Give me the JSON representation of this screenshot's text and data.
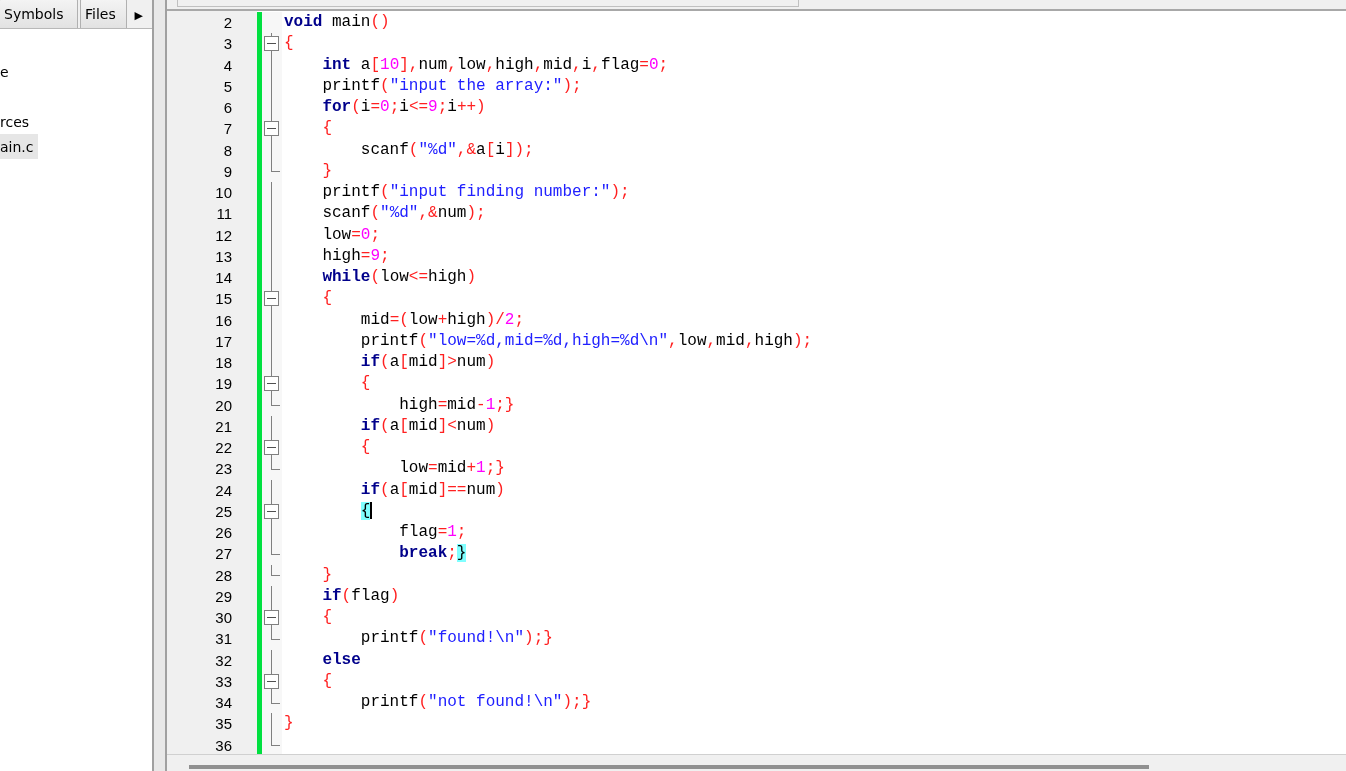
{
  "sidebar": {
    "tabs": [
      {
        "label": "Symbols",
        "selected": false
      },
      {
        "label": "Files",
        "selected": false
      }
    ],
    "scroll_button": "▶",
    "tree": [
      {
        "label": "e",
        "selected": false
      },
      {
        "label": "rces",
        "selected": false
      },
      {
        "label": "ain.c",
        "selected": true
      }
    ]
  },
  "editor": {
    "lines": [
      {
        "number": "2",
        "kind": "none",
        "tokens": [
          {
            "kind": "keyword",
            "text": "void"
          },
          {
            "kind": "name",
            "text": " main"
          },
          {
            "kind": "op",
            "text": "()"
          }
        ]
      },
      {
        "number": "3",
        "kind": "box",
        "tokens": [
          {
            "kind": "op",
            "text": "{"
          }
        ]
      },
      {
        "number": "4",
        "kind": "line",
        "tokens": [
          {
            "kind": "keyword",
            "text": "    int"
          },
          {
            "kind": "name",
            "text": " a"
          },
          {
            "kind": "op",
            "text": "["
          },
          {
            "kind": "number",
            "text": "10"
          },
          {
            "kind": "op",
            "text": "],"
          },
          {
            "kind": "name",
            "text": "num"
          },
          {
            "kind": "op",
            "text": ","
          },
          {
            "kind": "name",
            "text": "low"
          },
          {
            "kind": "op",
            "text": ","
          },
          {
            "kind": "name",
            "text": "high"
          },
          {
            "kind": "op",
            "text": ","
          },
          {
            "kind": "name",
            "text": "mid"
          },
          {
            "kind": "op",
            "text": ","
          },
          {
            "kind": "name",
            "text": "i"
          },
          {
            "kind": "op",
            "text": ","
          },
          {
            "kind": "name",
            "text": "flag"
          },
          {
            "kind": "op",
            "text": "="
          },
          {
            "kind": "number",
            "text": "0"
          },
          {
            "kind": "op",
            "text": ";"
          }
        ]
      },
      {
        "number": "5",
        "kind": "line",
        "tokens": [
          {
            "kind": "name",
            "text": "    printf"
          },
          {
            "kind": "op",
            "text": "("
          },
          {
            "kind": "string",
            "text": "\"input the array:\""
          },
          {
            "kind": "op",
            "text": ");"
          }
        ]
      },
      {
        "number": "6",
        "kind": "line",
        "tokens": [
          {
            "kind": "keyword",
            "text": "    for"
          },
          {
            "kind": "op",
            "text": "("
          },
          {
            "kind": "name",
            "text": "i"
          },
          {
            "kind": "op",
            "text": "="
          },
          {
            "kind": "number",
            "text": "0"
          },
          {
            "kind": "op",
            "text": ";"
          },
          {
            "kind": "name",
            "text": "i"
          },
          {
            "kind": "op",
            "text": "<="
          },
          {
            "kind": "number",
            "text": "9"
          },
          {
            "kind": "op",
            "text": ";"
          },
          {
            "kind": "name",
            "text": "i"
          },
          {
            "kind": "op",
            "text": "++)"
          }
        ]
      },
      {
        "number": "7",
        "kind": "box",
        "tokens": [
          {
            "kind": "op",
            "text": "    {"
          }
        ]
      },
      {
        "number": "8",
        "kind": "line",
        "tokens": [
          {
            "kind": "name",
            "text": "        scanf"
          },
          {
            "kind": "op",
            "text": "("
          },
          {
            "kind": "string",
            "text": "\"%d\""
          },
          {
            "kind": "op",
            "text": ",&"
          },
          {
            "kind": "name",
            "text": "a"
          },
          {
            "kind": "op",
            "text": "["
          },
          {
            "kind": "name",
            "text": "i"
          },
          {
            "kind": "op",
            "text": "]);"
          }
        ]
      },
      {
        "number": "9",
        "kind": "end",
        "tokens": [
          {
            "kind": "op",
            "text": "    }"
          }
        ]
      },
      {
        "number": "10",
        "kind": "line",
        "tokens": [
          {
            "kind": "name",
            "text": "    printf"
          },
          {
            "kind": "op",
            "text": "("
          },
          {
            "kind": "string",
            "text": "\"input finding number:\""
          },
          {
            "kind": "op",
            "text": ");"
          }
        ]
      },
      {
        "number": "11",
        "kind": "line",
        "tokens": [
          {
            "kind": "name",
            "text": "    scanf"
          },
          {
            "kind": "op",
            "text": "("
          },
          {
            "kind": "string",
            "text": "\"%d\""
          },
          {
            "kind": "op",
            "text": ",&"
          },
          {
            "kind": "name",
            "text": "num"
          },
          {
            "kind": "op",
            "text": ");"
          }
        ]
      },
      {
        "number": "12",
        "kind": "line",
        "tokens": [
          {
            "kind": "name",
            "text": "    low"
          },
          {
            "kind": "op",
            "text": "="
          },
          {
            "kind": "number",
            "text": "0"
          },
          {
            "kind": "op",
            "text": ";"
          }
        ]
      },
      {
        "number": "13",
        "kind": "line",
        "tokens": [
          {
            "kind": "name",
            "text": "    high"
          },
          {
            "kind": "op",
            "text": "="
          },
          {
            "kind": "number",
            "text": "9"
          },
          {
            "kind": "op",
            "text": ";"
          }
        ]
      },
      {
        "number": "14",
        "kind": "line",
        "tokens": [
          {
            "kind": "keyword",
            "text": "    while"
          },
          {
            "kind": "op",
            "text": "("
          },
          {
            "kind": "name",
            "text": "low"
          },
          {
            "kind": "op",
            "text": "<="
          },
          {
            "kind": "name",
            "text": "high"
          },
          {
            "kind": "op",
            "text": ")"
          }
        ]
      },
      {
        "number": "15",
        "kind": "box",
        "tokens": [
          {
            "kind": "op",
            "text": "    {"
          }
        ]
      },
      {
        "number": "16",
        "kind": "line",
        "tokens": [
          {
            "kind": "name",
            "text": "        mid"
          },
          {
            "kind": "op",
            "text": "=("
          },
          {
            "kind": "name",
            "text": "low"
          },
          {
            "kind": "op",
            "text": "+"
          },
          {
            "kind": "name",
            "text": "high"
          },
          {
            "kind": "op",
            "text": ")/"
          },
          {
            "kind": "number",
            "text": "2"
          },
          {
            "kind": "op",
            "text": ";"
          }
        ]
      },
      {
        "number": "17",
        "kind": "line",
        "tokens": [
          {
            "kind": "name",
            "text": "        printf"
          },
          {
            "kind": "op",
            "text": "("
          },
          {
            "kind": "string",
            "text": "\"low=%d,mid=%d,high=%d\\n\""
          },
          {
            "kind": "op",
            "text": ","
          },
          {
            "kind": "name",
            "text": "low"
          },
          {
            "kind": "op",
            "text": ","
          },
          {
            "kind": "name",
            "text": "mid"
          },
          {
            "kind": "op",
            "text": ","
          },
          {
            "kind": "name",
            "text": "high"
          },
          {
            "kind": "op",
            "text": ");"
          }
        ]
      },
      {
        "number": "18",
        "kind": "line",
        "tokens": [
          {
            "kind": "keyword",
            "text": "        if"
          },
          {
            "kind": "op",
            "text": "("
          },
          {
            "kind": "name",
            "text": "a"
          },
          {
            "kind": "op",
            "text": "["
          },
          {
            "kind": "name",
            "text": "mid"
          },
          {
            "kind": "op",
            "text": "]>"
          },
          {
            "kind": "name",
            "text": "num"
          },
          {
            "kind": "op",
            "text": ")"
          }
        ]
      },
      {
        "number": "19",
        "kind": "box",
        "tokens": [
          {
            "kind": "op",
            "text": "        {"
          }
        ]
      },
      {
        "number": "20",
        "kind": "end",
        "tokens": [
          {
            "kind": "name",
            "text": "            high"
          },
          {
            "kind": "op",
            "text": "="
          },
          {
            "kind": "name",
            "text": "mid"
          },
          {
            "kind": "op",
            "text": "-"
          },
          {
            "kind": "number",
            "text": "1"
          },
          {
            "kind": "op",
            "text": ";}"
          }
        ]
      },
      {
        "number": "21",
        "kind": "line",
        "tokens": [
          {
            "kind": "keyword",
            "text": "        if"
          },
          {
            "kind": "op",
            "text": "("
          },
          {
            "kind": "name",
            "text": "a"
          },
          {
            "kind": "op",
            "text": "["
          },
          {
            "kind": "name",
            "text": "mid"
          },
          {
            "kind": "op",
            "text": "]<"
          },
          {
            "kind": "name",
            "text": "num"
          },
          {
            "kind": "op",
            "text": ")"
          }
        ]
      },
      {
        "number": "22",
        "kind": "box",
        "tokens": [
          {
            "kind": "op",
            "text": "        {"
          }
        ]
      },
      {
        "number": "23",
        "kind": "end",
        "tokens": [
          {
            "kind": "name",
            "text": "            low"
          },
          {
            "kind": "op",
            "text": "="
          },
          {
            "kind": "name",
            "text": "mid"
          },
          {
            "kind": "op",
            "text": "+"
          },
          {
            "kind": "number",
            "text": "1"
          },
          {
            "kind": "op",
            "text": ";}"
          }
        ]
      },
      {
        "number": "24",
        "kind": "line",
        "tokens": [
          {
            "kind": "keyword",
            "text": "        if"
          },
          {
            "kind": "op",
            "text": "("
          },
          {
            "kind": "name",
            "text": "a"
          },
          {
            "kind": "op",
            "text": "["
          },
          {
            "kind": "name",
            "text": "mid"
          },
          {
            "kind": "op",
            "text": "]=="
          },
          {
            "kind": "name",
            "text": "num"
          },
          {
            "kind": "op",
            "text": ")"
          }
        ]
      },
      {
        "number": "25",
        "kind": "box",
        "caret": true,
        "tokens": [
          {
            "kind": "op",
            "text": "        {",
            "match": true
          }
        ]
      },
      {
        "number": "26",
        "kind": "line",
        "tokens": [
          {
            "kind": "name",
            "text": "            flag"
          },
          {
            "kind": "op",
            "text": "="
          },
          {
            "kind": "number",
            "text": "1"
          },
          {
            "kind": "op",
            "text": ";"
          }
        ]
      },
      {
        "number": "27",
        "kind": "end",
        "tokens": [
          {
            "kind": "keyword",
            "text": "            break"
          },
          {
            "kind": "op",
            "text": ";"
          },
          {
            "kind": "op",
            "text": "}",
            "match": true
          }
        ]
      },
      {
        "number": "28",
        "kind": "end",
        "tokens": [
          {
            "kind": "op",
            "text": "    }"
          }
        ]
      },
      {
        "number": "29",
        "kind": "line",
        "tokens": [
          {
            "kind": "keyword",
            "text": "    if"
          },
          {
            "kind": "op",
            "text": "("
          },
          {
            "kind": "name",
            "text": "flag"
          },
          {
            "kind": "op",
            "text": ")"
          }
        ]
      },
      {
        "number": "30",
        "kind": "box",
        "tokens": [
          {
            "kind": "op",
            "text": "    {"
          }
        ]
      },
      {
        "number": "31",
        "kind": "end",
        "tokens": [
          {
            "kind": "name",
            "text": "        printf"
          },
          {
            "kind": "op",
            "text": "("
          },
          {
            "kind": "string",
            "text": "\"found!\\n\""
          },
          {
            "kind": "op",
            "text": ");}"
          }
        ]
      },
      {
        "number": "32",
        "kind": "line",
        "tokens": [
          {
            "kind": "keyword",
            "text": "    else"
          }
        ]
      },
      {
        "number": "33",
        "kind": "box",
        "tokens": [
          {
            "kind": "op",
            "text": "    {"
          }
        ]
      },
      {
        "number": "34",
        "kind": "end",
        "tokens": [
          {
            "kind": "name",
            "text": "        printf"
          },
          {
            "kind": "op",
            "text": "("
          },
          {
            "kind": "string",
            "text": "\"not found!\\n\""
          },
          {
            "kind": "op",
            "text": ");}"
          }
        ]
      },
      {
        "number": "35",
        "kind": "line",
        "tokens": [
          {
            "kind": "op",
            "text": "}"
          }
        ]
      },
      {
        "number": "36",
        "kind": "end"
      }
    ]
  }
}
